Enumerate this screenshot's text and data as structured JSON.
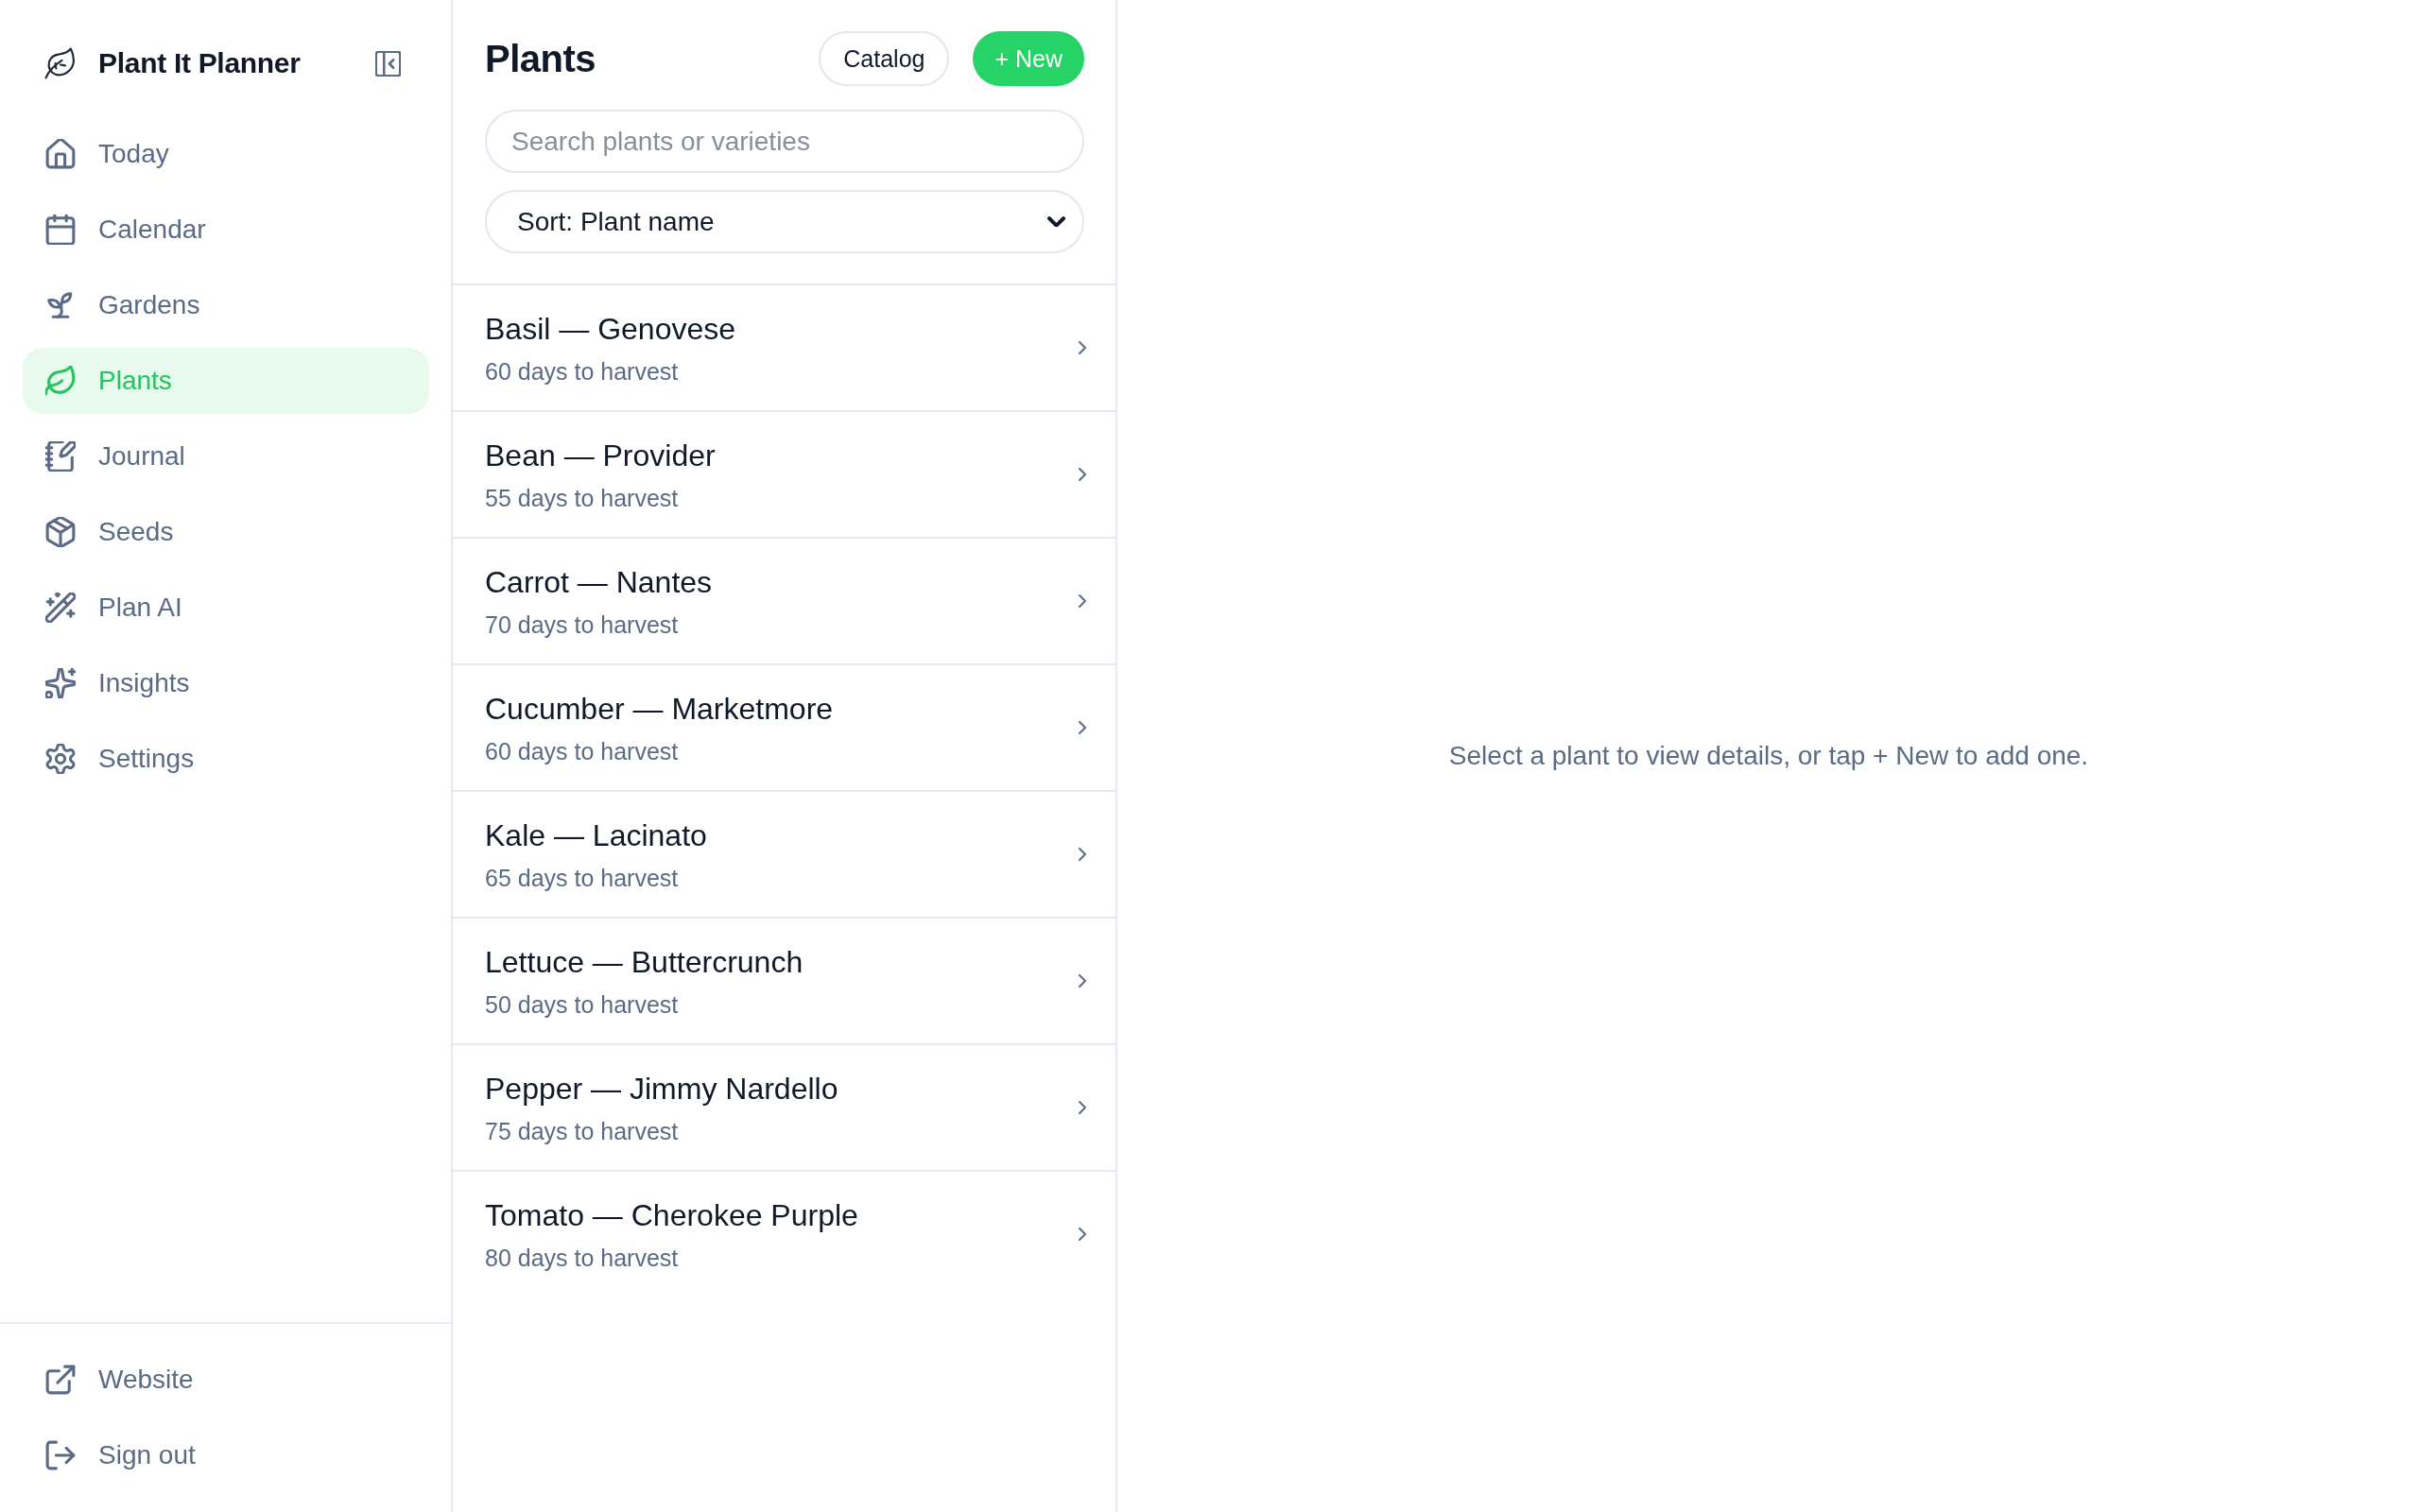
{
  "sidebar": {
    "app_title": "Plant It Planner",
    "nav": [
      {
        "label": "Today",
        "selected": false
      },
      {
        "label": "Calendar",
        "selected": false
      },
      {
        "label": "Gardens",
        "selected": false
      },
      {
        "label": "Plants",
        "selected": true
      },
      {
        "label": "Journal",
        "selected": false
      },
      {
        "label": "Seeds",
        "selected": false
      },
      {
        "label": "Plan AI",
        "selected": false
      },
      {
        "label": "Insights",
        "selected": false
      },
      {
        "label": "Settings",
        "selected": false
      }
    ],
    "footer": [
      {
        "label": "Website"
      },
      {
        "label": "Sign out"
      }
    ]
  },
  "plants_panel": {
    "title": "Plants",
    "catalog_button": {
      "label": "Catalog"
    },
    "new_button": {
      "label": "+ New"
    },
    "search": {
      "placeholder": "Search plants or varieties"
    },
    "sort": {
      "value": "Sort: Plant name"
    },
    "items": [
      {
        "name": "Basil — Genovese",
        "subtitle": "60 days to harvest"
      },
      {
        "name": "Bean — Provider",
        "subtitle": "55 days to harvest"
      },
      {
        "name": "Carrot — Nantes",
        "subtitle": "70 days to harvest"
      },
      {
        "name": "Cucumber — Marketmore",
        "subtitle": "60 days to harvest"
      },
      {
        "name": "Kale — Lacinato",
        "subtitle": "65 days to harvest"
      },
      {
        "name": "Lettuce — Buttercrunch",
        "subtitle": "50 days to harvest"
      },
      {
        "name": "Pepper — Jimmy Nardello",
        "subtitle": "75 days to harvest"
      },
      {
        "name": "Tomato — Cherokee Purple",
        "subtitle": "80 days to harvest"
      }
    ]
  },
  "detail": {
    "empty_message": "Select a plant to view details, or tap + New to add one."
  }
}
